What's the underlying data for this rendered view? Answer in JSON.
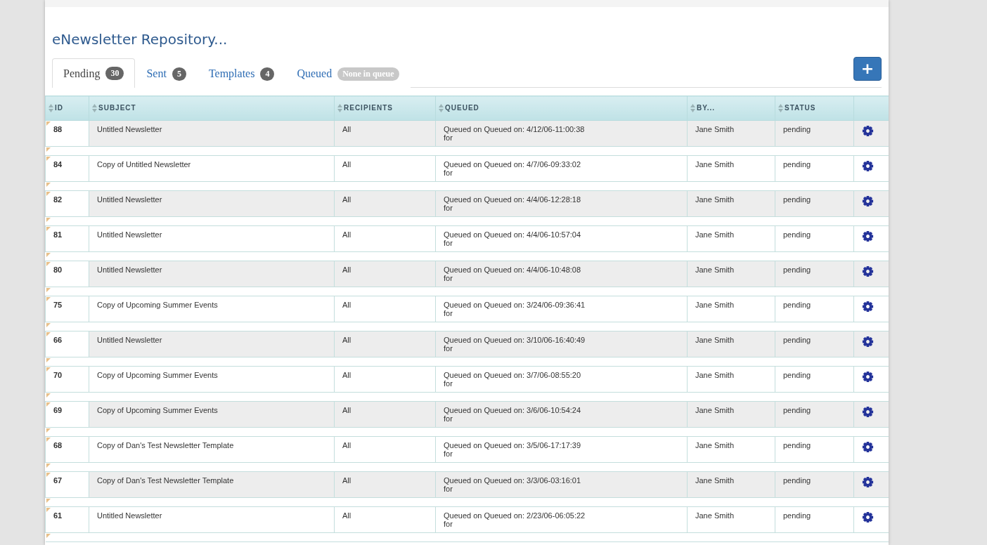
{
  "title": "eNewsletter Repository...",
  "tabs": [
    {
      "label": "Pending",
      "badge": "30",
      "selected": true,
      "empty": false
    },
    {
      "label": "Sent",
      "badge": "5",
      "selected": false,
      "empty": false
    },
    {
      "label": "Templates",
      "badge": "4",
      "selected": false,
      "empty": false
    },
    {
      "label": "Queued",
      "badge": "None in queue",
      "selected": false,
      "empty": true
    }
  ],
  "add_button": "+",
  "table": {
    "columns": [
      "ID",
      "SUBJECT",
      "RECIPIENTS",
      "QUEUED",
      "BY...",
      "STATUS"
    ],
    "rows": [
      {
        "id": "88",
        "subject": "Untitled Newsletter",
        "recipients": "All",
        "queued": "Queued on Queued on: 4/12/06-11:00:38",
        "queued_for": "for",
        "by": "Jane Smith",
        "status": "pending"
      },
      {
        "id": "84",
        "subject": "Copy of Untitled Newsletter",
        "recipients": "All",
        "queued": "Queued on Queued on: 4/7/06-09:33:02",
        "queued_for": "for",
        "by": "Jane Smith",
        "status": "pending"
      },
      {
        "id": "82",
        "subject": "Untitled Newsletter",
        "recipients": "All",
        "queued": "Queued on Queued on: 4/4/06-12:28:18",
        "queued_for": "for",
        "by": "Jane Smith",
        "status": "pending"
      },
      {
        "id": "81",
        "subject": "Untitled Newsletter",
        "recipients": "All",
        "queued": "Queued on Queued on: 4/4/06-10:57:04",
        "queued_for": "for",
        "by": "Jane Smith",
        "status": "pending"
      },
      {
        "id": "80",
        "subject": "Untitled Newsletter",
        "recipients": "All",
        "queued": "Queued on Queued on: 4/4/06-10:48:08",
        "queued_for": "for",
        "by": "Jane Smith",
        "status": "pending"
      },
      {
        "id": "75",
        "subject": "Copy of Upcoming Summer Events",
        "recipients": "All",
        "queued": "Queued on Queued on: 3/24/06-09:36:41",
        "queued_for": "for",
        "by": "Jane Smith",
        "status": "pending"
      },
      {
        "id": "66",
        "subject": "Untitled Newsletter",
        "recipients": "All",
        "queued": "Queued on Queued on: 3/10/06-16:40:49",
        "queued_for": "for",
        "by": "Jane Smith",
        "status": "pending"
      },
      {
        "id": "70",
        "subject": "Copy of Upcoming Summer Events",
        "recipients": "All",
        "queued": "Queued on Queued on: 3/7/06-08:55:20",
        "queued_for": "for",
        "by": "Jane Smith",
        "status": "pending"
      },
      {
        "id": "69",
        "subject": "Copy of Upcoming Summer Events",
        "recipients": "All",
        "queued": "Queued on Queued on: 3/6/06-10:54:24",
        "queued_for": "for",
        "by": "Jane Smith",
        "status": "pending"
      },
      {
        "id": "68",
        "subject": "Copy of Dan's Test Newsletter Template",
        "recipients": "All",
        "queued": "Queued on Queued on: 3/5/06-17:17:39",
        "queued_for": "for",
        "by": "Jane Smith",
        "status": "pending"
      },
      {
        "id": "67",
        "subject": "Copy of Dan's Test Newsletter Template",
        "recipients": "All",
        "queued": "Queued on Queued on: 3/3/06-03:16:01",
        "queued_for": "for",
        "by": "Jane Smith",
        "status": "pending"
      },
      {
        "id": "61",
        "subject": "Untitled Newsletter",
        "recipients": "All",
        "queued": "Queued on Queued on: 2/23/06-06:05:22",
        "queued_for": "for",
        "by": "Jane Smith",
        "status": "pending"
      }
    ]
  }
}
